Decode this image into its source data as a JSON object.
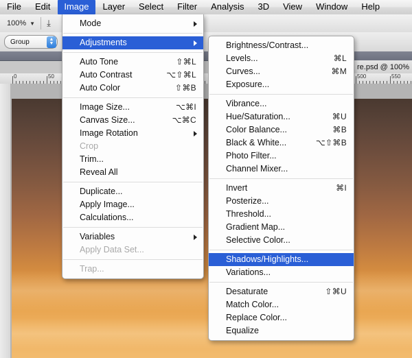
{
  "menubar": {
    "items": [
      {
        "label": "File",
        "active": false
      },
      {
        "label": "Edit",
        "active": false
      },
      {
        "label": "Image",
        "active": true
      },
      {
        "label": "Layer",
        "active": false
      },
      {
        "label": "Select",
        "active": false
      },
      {
        "label": "Filter",
        "active": false
      },
      {
        "label": "Analysis",
        "active": false
      },
      {
        "label": "3D",
        "active": false
      },
      {
        "label": "View",
        "active": false
      },
      {
        "label": "Window",
        "active": false
      },
      {
        "label": "Help",
        "active": false
      }
    ]
  },
  "options_bar": {
    "zoom_value": "100%",
    "zoom_caret": "▼"
  },
  "second_bar": {
    "combo_value": "Group",
    "stepper_up": "▲",
    "stepper_down": "▼"
  },
  "document": {
    "tab_label": "re.psd @ 100%"
  },
  "rulers": {
    "horizontal_labels": [
      "0",
      "50",
      "500",
      "550"
    ]
  },
  "image_menu": {
    "items": [
      {
        "label": "Mode",
        "shortcut": "",
        "submenu": true,
        "disabled": false,
        "highlight": false
      },
      {
        "separator": true
      },
      {
        "label": "Adjustments",
        "shortcut": "",
        "submenu": true,
        "disabled": false,
        "highlight": true
      },
      {
        "separator": true
      },
      {
        "label": "Auto Tone",
        "shortcut": "⇧⌘L",
        "submenu": false,
        "disabled": false,
        "highlight": false
      },
      {
        "label": "Auto Contrast",
        "shortcut": "⌥⇧⌘L",
        "submenu": false,
        "disabled": false,
        "highlight": false
      },
      {
        "label": "Auto Color",
        "shortcut": "⇧⌘B",
        "submenu": false,
        "disabled": false,
        "highlight": false
      },
      {
        "separator": true
      },
      {
        "label": "Image Size...",
        "shortcut": "⌥⌘I",
        "submenu": false,
        "disabled": false,
        "highlight": false
      },
      {
        "label": "Canvas Size...",
        "shortcut": "⌥⌘C",
        "submenu": false,
        "disabled": false,
        "highlight": false
      },
      {
        "label": "Image Rotation",
        "shortcut": "",
        "submenu": true,
        "disabled": false,
        "highlight": false
      },
      {
        "label": "Crop",
        "shortcut": "",
        "submenu": false,
        "disabled": true,
        "highlight": false
      },
      {
        "label": "Trim...",
        "shortcut": "",
        "submenu": false,
        "disabled": false,
        "highlight": false
      },
      {
        "label": "Reveal All",
        "shortcut": "",
        "submenu": false,
        "disabled": false,
        "highlight": false
      },
      {
        "separator": true
      },
      {
        "label": "Duplicate...",
        "shortcut": "",
        "submenu": false,
        "disabled": false,
        "highlight": false
      },
      {
        "label": "Apply Image...",
        "shortcut": "",
        "submenu": false,
        "disabled": false,
        "highlight": false
      },
      {
        "label": "Calculations...",
        "shortcut": "",
        "submenu": false,
        "disabled": false,
        "highlight": false
      },
      {
        "separator": true
      },
      {
        "label": "Variables",
        "shortcut": "",
        "submenu": true,
        "disabled": false,
        "highlight": false
      },
      {
        "label": "Apply Data Set...",
        "shortcut": "",
        "submenu": false,
        "disabled": true,
        "highlight": false
      },
      {
        "separator": true
      },
      {
        "label": "Trap...",
        "shortcut": "",
        "submenu": false,
        "disabled": true,
        "highlight": false
      }
    ]
  },
  "adjustments_submenu": {
    "items": [
      {
        "label": "Brightness/Contrast...",
        "shortcut": "",
        "disabled": false,
        "highlight": false
      },
      {
        "label": "Levels...",
        "shortcut": "⌘L",
        "disabled": false,
        "highlight": false
      },
      {
        "label": "Curves...",
        "shortcut": "⌘M",
        "disabled": false,
        "highlight": false
      },
      {
        "label": "Exposure...",
        "shortcut": "",
        "disabled": false,
        "highlight": false
      },
      {
        "separator": true
      },
      {
        "label": "Vibrance...",
        "shortcut": "",
        "disabled": false,
        "highlight": false
      },
      {
        "label": "Hue/Saturation...",
        "shortcut": "⌘U",
        "disabled": false,
        "highlight": false
      },
      {
        "label": "Color Balance...",
        "shortcut": "⌘B",
        "disabled": false,
        "highlight": false
      },
      {
        "label": "Black & White...",
        "shortcut": "⌥⇧⌘B",
        "disabled": false,
        "highlight": false
      },
      {
        "label": "Photo Filter...",
        "shortcut": "",
        "disabled": false,
        "highlight": false
      },
      {
        "label": "Channel Mixer...",
        "shortcut": "",
        "disabled": false,
        "highlight": false
      },
      {
        "separator": true
      },
      {
        "label": "Invert",
        "shortcut": "⌘I",
        "disabled": false,
        "highlight": false
      },
      {
        "label": "Posterize...",
        "shortcut": "",
        "disabled": false,
        "highlight": false
      },
      {
        "label": "Threshold...",
        "shortcut": "",
        "disabled": false,
        "highlight": false
      },
      {
        "label": "Gradient Map...",
        "shortcut": "",
        "disabled": false,
        "highlight": false
      },
      {
        "label": "Selective Color...",
        "shortcut": "",
        "disabled": false,
        "highlight": false
      },
      {
        "separator": true
      },
      {
        "label": "Shadows/Highlights...",
        "shortcut": "",
        "disabled": false,
        "highlight": true
      },
      {
        "label": "Variations...",
        "shortcut": "",
        "disabled": false,
        "highlight": false
      },
      {
        "separator": true
      },
      {
        "label": "Desaturate",
        "shortcut": "⇧⌘U",
        "disabled": false,
        "highlight": false
      },
      {
        "label": "Match Color...",
        "shortcut": "",
        "disabled": false,
        "highlight": false
      },
      {
        "label": "Replace Color...",
        "shortcut": "",
        "disabled": false,
        "highlight": false
      },
      {
        "label": "Equalize",
        "shortcut": "",
        "disabled": false,
        "highlight": false
      }
    ]
  },
  "colors": {
    "menu_highlight": "#2a5fd6",
    "menu_bg": "#fdfdfd",
    "disabled_text": "#a9a9a9",
    "photo_top": "#4a3930",
    "photo_bottom": "#f2bb6e"
  }
}
